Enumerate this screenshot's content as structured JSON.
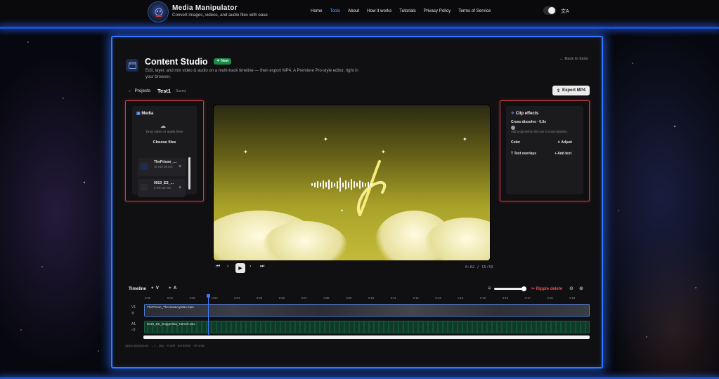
{
  "brand": {
    "title": "Media Manipulator",
    "subtitle": "Convert images, videos, and audio files with ease"
  },
  "nav": {
    "items": [
      "Home",
      "Tools",
      "About",
      "How it works",
      "Tutorials",
      "Privacy Policy",
      "Terms of Service"
    ],
    "active": "Tools",
    "translate_glyph": "文A"
  },
  "studio": {
    "title": "Content Studio",
    "badge": "New",
    "description": "Edit, layer, and mix video & audio on a multi-track timeline — then export MP4. A Premiere Pro-style editor, right in your browser.",
    "back_label": "← Back to tools",
    "projects_label": "Projects",
    "project_name": "Test1",
    "saved_label": "Saved",
    "export_label": "Export MP4"
  },
  "media_panel": {
    "title": "Media",
    "drop_text": "Drop video or audio here",
    "choose_files": "Choose files",
    "items": [
      {
        "name": "ThePrison_…",
        "duration": "16 min 59 sec"
      },
      {
        "name": "0010_ES_…",
        "duration": "3 min 42 sec"
      }
    ]
  },
  "effects_panel": {
    "title": "Clip effects",
    "crossfade_label": "Cross-dissolve · 0.0s",
    "crossfade_hint": "Add a clip before this one to cross-dissolve.",
    "color_label": "Color",
    "adjust_label": "Adjust",
    "overlays_label": "Text overlays",
    "add_text_label": "Add text"
  },
  "player": {
    "timecode": "0:02 / 15:59"
  },
  "timeline": {
    "title": "Timeline",
    "add_video": "V",
    "add_audio": "A",
    "ripple_delete": "Ripple delete",
    "ticks": [
      "0:00",
      "0:02",
      "0:03",
      "0:03",
      "0:04",
      "0:05",
      "0:06",
      "0:07",
      "0:08",
      "0:09",
      "0:10",
      "0:11",
      "0:12",
      "0:13",
      "0:14",
      "0:15",
      "0:16",
      "0:17",
      "0:18",
      "0:19"
    ],
    "tracks": [
      {
        "label": "V1",
        "clip": "ThePrison_TheUnsavvyMan.mp4"
      },
      {
        "label": "A1",
        "clip": "0010_ES_Doggerska_Taesch.wav"
      }
    ],
    "hint": "Space play/pause · ←/→ step · S split · Del delete · ⌫ undo"
  },
  "colors": {
    "accent": "#2f78ff",
    "panel_outline": "#d13a44",
    "ripple": "#e0525a",
    "badge": "#1d8a4a"
  }
}
